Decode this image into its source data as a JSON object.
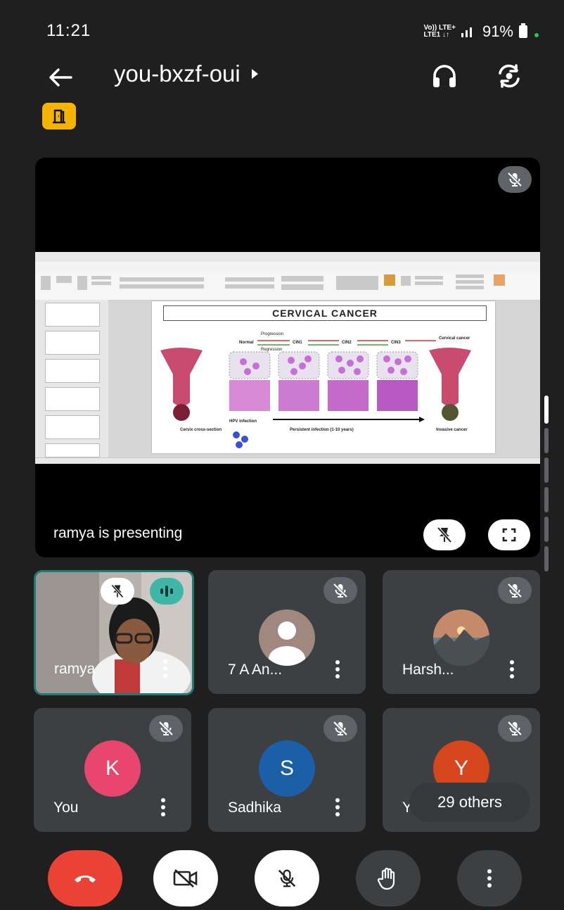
{
  "status": {
    "time": "11:21",
    "network": "Vo)) LTE+ LTE1",
    "battery": "91%"
  },
  "header": {
    "title": "you-bxzf-oui"
  },
  "presentation": {
    "presenting_text": "ramya is presenting",
    "slide": {
      "title": "CERVICAL CANCER",
      "stages": [
        "Normal",
        "CIN1",
        "CIN2",
        "CIN3",
        "Cervical cancer"
      ],
      "progression": "Progression",
      "regression": "Regression",
      "hpv": "HPV infection",
      "persistent": "Persistent infection (1-10 years)",
      "cervix": "Cervix cross-section",
      "invasive": "Invasive cancer"
    }
  },
  "participants": [
    {
      "name": "ramya"
    },
    {
      "name": "7 A An..."
    },
    {
      "name": "Harsh..."
    },
    {
      "name": "You",
      "initial": "K",
      "color": "#e8466f"
    },
    {
      "name": "Sadhika",
      "initial": "S",
      "color": "#1a5fa8"
    },
    {
      "name": "Yu",
      "initial": "Y",
      "color": "#d6451b"
    }
  ],
  "others_label": "29 others",
  "colors": {
    "end_call": "#ea4335",
    "background": "#1f1f1f",
    "tile": "#3c4043"
  }
}
